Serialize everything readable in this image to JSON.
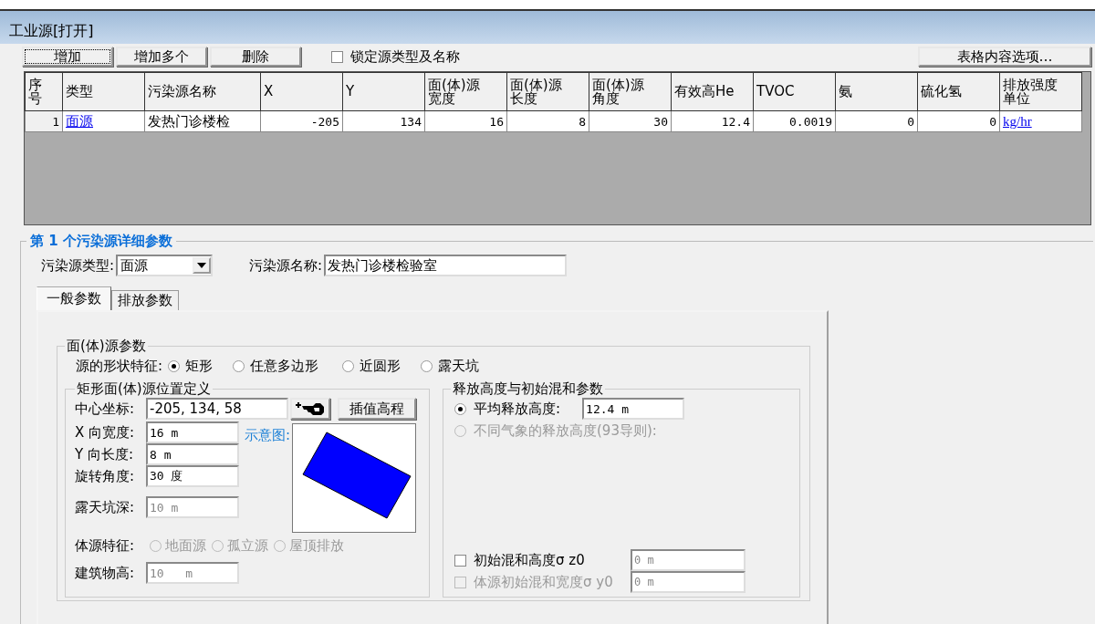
{
  "window": {
    "title": "工业源[打开]"
  },
  "toolbar": {
    "buttons": [
      {
        "label": "增加",
        "focused": true
      },
      {
        "label": "增加多个",
        "focused": false
      },
      {
        "label": "删除",
        "focused": false
      }
    ],
    "lock_checkbox": {
      "label": "锁定源类型及名称",
      "checked": false
    },
    "options_button": "表格内容选项…"
  },
  "table": {
    "columns": [
      {
        "label": "序号",
        "kind": "index"
      },
      {
        "label": "类型",
        "kind": "link"
      },
      {
        "label": "污染源名称",
        "kind": "text"
      },
      {
        "label": "X",
        "kind": "number"
      },
      {
        "label": "Y",
        "kind": "number"
      },
      {
        "label": "面(体)源宽度",
        "kind": "number"
      },
      {
        "label": "面(体)源长度",
        "kind": "number"
      },
      {
        "label": "面(体)源角度",
        "kind": "number"
      },
      {
        "label": "有效高He",
        "kind": "number"
      },
      {
        "label": "TVOC",
        "kind": "number"
      },
      {
        "label": "氨",
        "kind": "number"
      },
      {
        "label": "硫化氢",
        "kind": "number"
      },
      {
        "label": "排放强度单位",
        "kind": "link"
      }
    ],
    "rows": [
      {
        "cells": [
          "1",
          "面源",
          "发热门诊楼检",
          "-205",
          "134",
          "16",
          "8",
          "30",
          "12.4",
          "0.0019",
          "0",
          "0",
          "kg/hr"
        ]
      }
    ]
  },
  "detail": {
    "title": "第 1 个污染源详细参数",
    "type_label": "污染源类型:",
    "type_value": "面源",
    "name_label": "污染源名称:",
    "name_value": "发热门诊楼检验室",
    "tabs": [
      {
        "label": "一般参数",
        "selected": true
      },
      {
        "label": "排放参数",
        "selected": false
      }
    ],
    "area_group": {
      "title": "面(体)源参数",
      "shape_label": "源的形状特征:",
      "shapes": [
        {
          "label": "矩形",
          "selected": true
        },
        {
          "label": "任意多边形",
          "selected": false
        },
        {
          "label": "近圆形",
          "selected": false
        },
        {
          "label": "露天坑",
          "selected": false
        }
      ],
      "rect_group": {
        "title": "矩形面(体)源位置定义",
        "center": {
          "label": "中心坐标:",
          "value": "-205, 134, 58"
        },
        "interp_button": "插值高程",
        "fields": [
          {
            "label": "X 向宽度:",
            "value": "16 m",
            "disabled": false
          },
          {
            "label": "Y 向长度:",
            "value": "8 m",
            "disabled": false
          },
          {
            "label": "旋转角度:",
            "value": "30 度",
            "disabled": false
          },
          {
            "label": "露天坑深:",
            "value": "10 m",
            "disabled": true
          }
        ],
        "diagram_label": "示意图:",
        "body_label": "体源特征:",
        "body_types": [
          {
            "label": "地面源",
            "selected": false,
            "disabled": true
          },
          {
            "label": "孤立源",
            "selected": false,
            "disabled": true
          },
          {
            "label": "屋顶排放",
            "selected": false,
            "disabled": true
          }
        ],
        "building": {
          "label": "建筑物高:",
          "value": "10   m",
          "disabled": true
        }
      },
      "release_group": {
        "title": "释放高度与初始混和参数",
        "options": [
          {
            "label": "平均释放高度:",
            "selected": true,
            "disabled": false,
            "value": "12.4 m"
          },
          {
            "label": "不同气象的释放高度(93导则):",
            "selected": false,
            "disabled": true
          }
        ],
        "mixing": [
          {
            "label": "初始混和高度σ z0",
            "checked": false,
            "disabled": false,
            "value": "0 m"
          },
          {
            "label": "体源初始混和宽度σ y0",
            "checked": false,
            "disabled": true,
            "value": "0 m"
          }
        ]
      }
    }
  }
}
